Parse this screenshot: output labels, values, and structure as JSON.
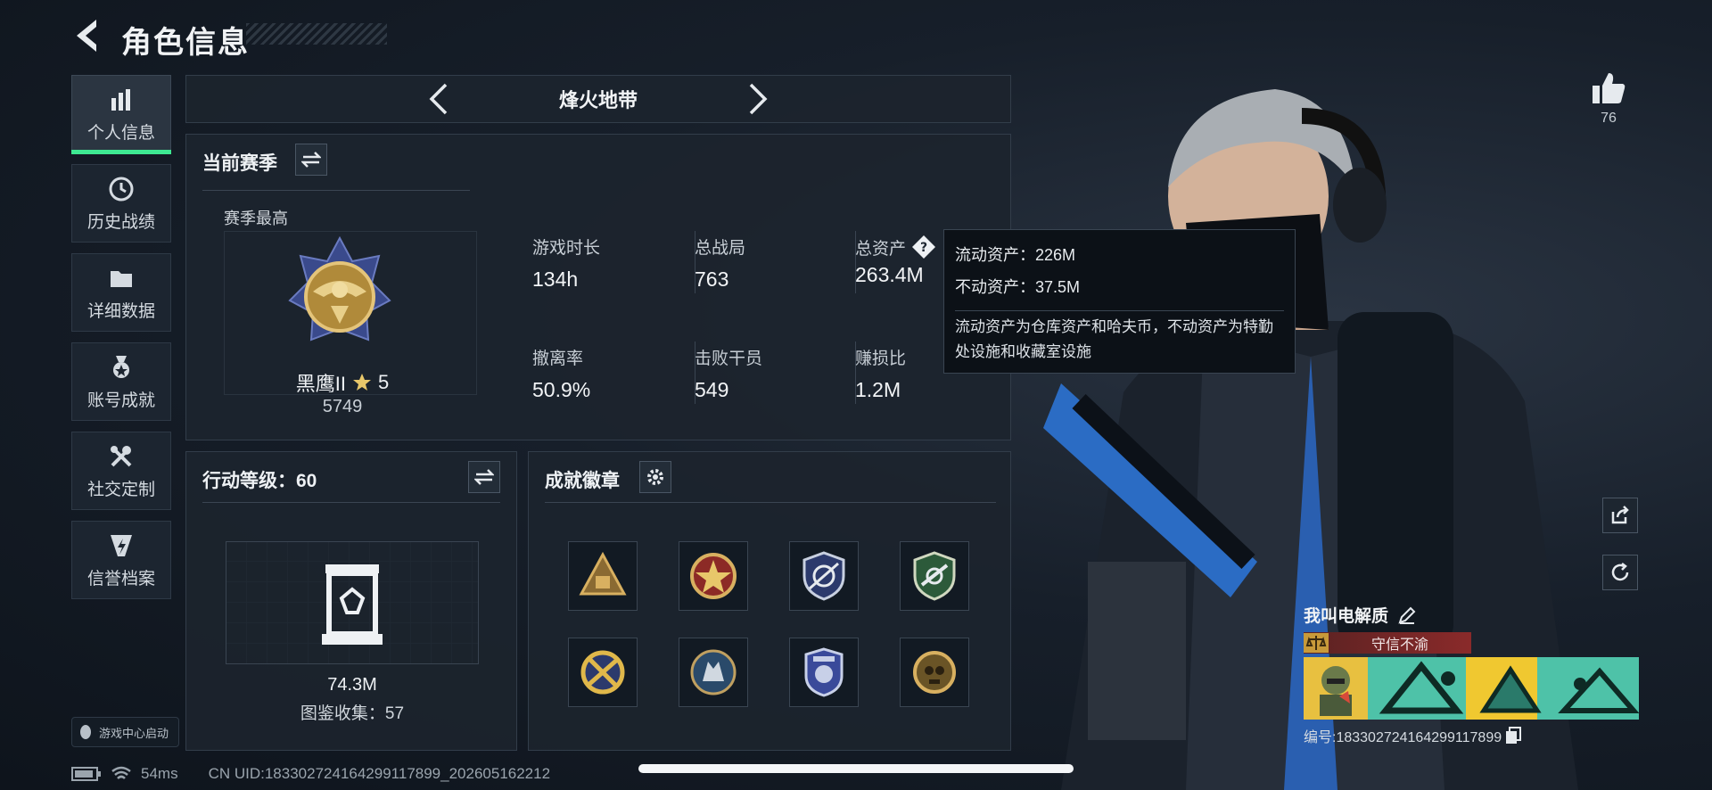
{
  "header": {
    "title": "角色信息"
  },
  "nav": [
    {
      "label": "个人信息",
      "icon": "bar-chart-icon",
      "active": true
    },
    {
      "label": "历史战绩",
      "icon": "history-clock-icon"
    },
    {
      "label": "详细数据",
      "icon": "folder-icon"
    },
    {
      "label": "账号成就",
      "icon": "medal-icon"
    },
    {
      "label": "社交定制",
      "icon": "tools-icon"
    },
    {
      "label": "信誉档案",
      "icon": "credit-badge-icon"
    }
  ],
  "game_center": "游戏中心启动",
  "mode_tab": "烽火地带",
  "season": {
    "header": "当前赛季",
    "best_label": "赛季最高",
    "rank_name": "黑鹰II",
    "rank_stars": "5",
    "rank_points": "5749",
    "stats": [
      {
        "label": "游戏时长",
        "value": "134h"
      },
      {
        "label": "总战局",
        "value": "763"
      },
      {
        "label": "总资产",
        "value": "263.4M"
      },
      {
        "label": "撤离率",
        "value": "50.9%"
      },
      {
        "label": "击败干员",
        "value": "549"
      },
      {
        "label": "赚损比",
        "value": "1.2M"
      }
    ]
  },
  "tooltip": {
    "line1": "流动资产：226M",
    "line2": "不动资产：37.5M",
    "desc": "流动资产为仓库资产和哈夫币，不动资产为特勤处设施和收藏室设施"
  },
  "level": {
    "title": "行动等级：60",
    "value": "74.3M",
    "collection": "图鉴收集：57"
  },
  "badges": {
    "title": "成就徽章",
    "items": [
      "triangle-pyramid-badge",
      "red-star-badge",
      "shield-rifle-badge",
      "green-shield-badge",
      "gold-cross-badge",
      "wolf-badge",
      "blue-shield-badge",
      "gold-skull-badge"
    ]
  },
  "likes": "76",
  "player": {
    "name": "我叫电解质",
    "credit_tag": "守信不渝",
    "id_label": "编号:183302724164299117899"
  },
  "status_bar": {
    "ping": "54ms",
    "uid": "CN UID:183302724164299117899_202605162212"
  }
}
